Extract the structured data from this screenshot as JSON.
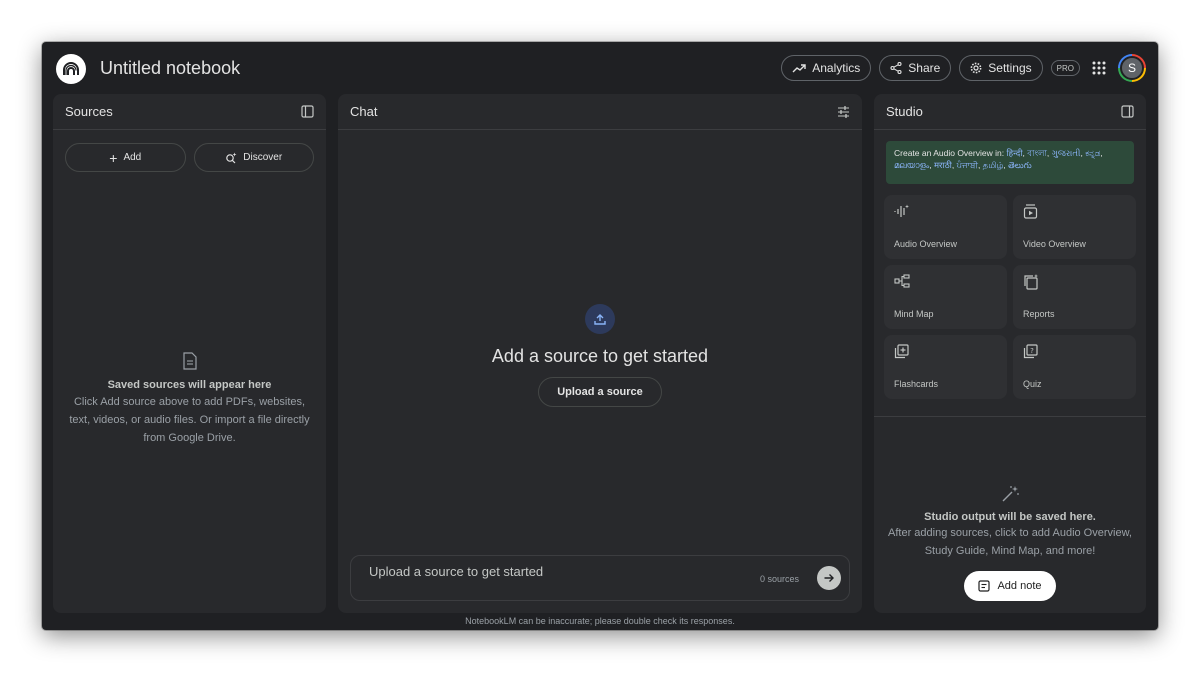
{
  "header": {
    "title": "Untitled notebook",
    "analytics": "Analytics",
    "share": "Share",
    "settings": "Settings",
    "pro": "PRO",
    "avatar": "S"
  },
  "sources": {
    "title": "Sources",
    "add": "Add",
    "discover": "Discover",
    "empty_title": "Saved sources will appear here",
    "empty_desc": "Click Add source above to add PDFs, websites, text, videos, or audio files. Or import a file directly from Google Drive."
  },
  "chat": {
    "title": "Chat",
    "heading": "Add a source to get started",
    "upload": "Upload a source",
    "input_placeholder": "Upload a source to get started",
    "count": "0 sources"
  },
  "studio": {
    "title": "Studio",
    "overview_prefix": "Create an Audio Overview in:",
    "languages": [
      "हिन्दी",
      "বাংলা",
      "ગુજરાતી",
      "ಕನ್ನಡ",
      "മലയാളം",
      "मराठी",
      "ਪੰਜਾਬੀ",
      "தமிழ்",
      "తెలుగు"
    ],
    "tiles": [
      "Audio Overview",
      "Video Overview",
      "Mind Map",
      "Reports",
      "Flashcards",
      "Quiz"
    ],
    "empty_title": "Studio output will be saved here.",
    "empty_desc": "After adding sources, click to add Audio Overview, Study Guide, Mind Map, and more!",
    "add_note": "Add note"
  },
  "footer": "NotebookLM can be inaccurate; please double check its responses."
}
